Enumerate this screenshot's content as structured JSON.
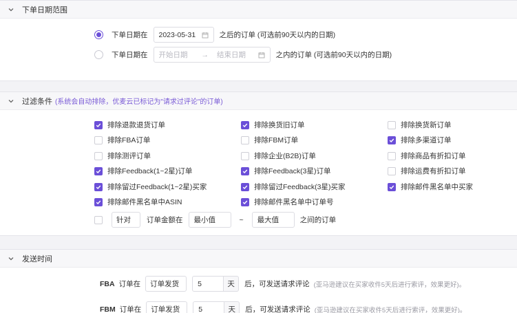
{
  "order_date": {
    "title": "下单日期范围",
    "option1": {
      "prefix": "下单日期在",
      "date": "2023-05-31",
      "suffix": "之后的订单 (可选前90天以内的日期)",
      "selected": true
    },
    "option2": {
      "prefix": "下单日期在",
      "start_placeholder": "开始日期",
      "arrow": "→",
      "end_placeholder": "结束日期",
      "suffix": "之内的订单 (可选前90天以内的日期)",
      "selected": false
    }
  },
  "filters": {
    "title": "过滤条件",
    "note": "(系统会自动排除，优麦云已标记为\"请求过评论\"的订单)",
    "options": [
      {
        "label": "排除退款退货订单",
        "checked": true
      },
      {
        "label": "排除换货旧订单",
        "checked": true
      },
      {
        "label": "排除换货新订单",
        "checked": false
      },
      {
        "label": "排除FBA订单",
        "checked": false
      },
      {
        "label": "排除FBM订单",
        "checked": false
      },
      {
        "label": "排除多渠道订单",
        "checked": true
      },
      {
        "label": "排除测评订单",
        "checked": false
      },
      {
        "label": "排除企业(B2B)订单",
        "checked": false
      },
      {
        "label": "排除商品有折扣订单",
        "checked": false
      },
      {
        "label": "排除Feedback(1~2星)订单",
        "checked": true
      },
      {
        "label": "排除Feedback(3星)订单",
        "checked": true
      },
      {
        "label": "排除运费有折扣订单",
        "checked": false
      },
      {
        "label": "排除留过Feedback(1~2星)买家",
        "checked": true
      },
      {
        "label": "排除留过Feedback(3星)买家",
        "checked": true
      },
      {
        "label": "排除邮件黑名单中买家",
        "checked": true
      },
      {
        "label": "排除邮件黑名单中ASIN",
        "checked": true
      },
      {
        "label": "排除邮件黑名单中订单号",
        "checked": true
      }
    ],
    "amount": {
      "checked": false,
      "select_value": "针对",
      "middle": "订单金额在",
      "min_placeholder": "最小值",
      "tilde": "~",
      "max_placeholder": "最大值",
      "suffix": "之间的订单"
    }
  },
  "send_time": {
    "title": "发送时间",
    "rows": [
      {
        "channel": "FBA",
        "prefix": "订单在",
        "select_value": "订单发货",
        "days": "5",
        "unit": "天",
        "after": "后，可发送请求评论",
        "hint": "(亚马逊建议在买家收件5天后进行索评，效果更好)。"
      },
      {
        "channel": "FBM",
        "prefix": "订单在",
        "select_value": "订单发货",
        "days": "5",
        "unit": "天",
        "after": "后，可发送请求评论",
        "hint": "(亚马逊建议在买家收件5天后进行索评，效果更好)。"
      }
    ]
  },
  "colors": {
    "accent": "#6b4fd8",
    "note": "#7a5bd6"
  }
}
